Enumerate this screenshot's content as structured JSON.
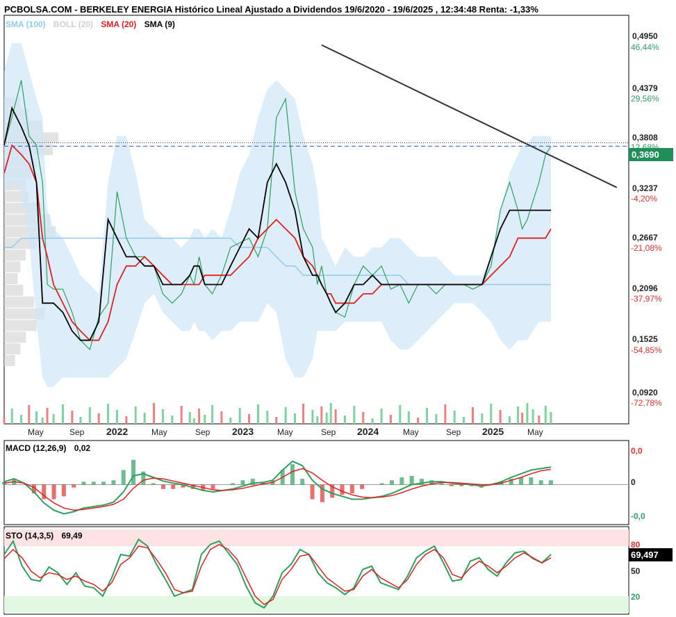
{
  "title": "PCBOLSA.COM - BERKELEY ENERGIA Histórico Lineal Ajustado a Dividendos 19/6/2020 - 19/6/2025 , 12:34:48 Renta: -1,33%",
  "legend": [
    {
      "label": "SMA (100)",
      "color": "#8fcbef"
    },
    {
      "label": "BOLL (20)",
      "color": "#d7d7d7"
    },
    {
      "label": "SMA (20)",
      "color": "#e02020"
    },
    {
      "label": "SMA (9)",
      "color": "#000000"
    }
  ],
  "price_axis": [
    {
      "price": "0,4950",
      "pct": "46,44%",
      "pct_color": "#2e9f5e"
    },
    {
      "price": "0,4379",
      "pct": "29,56%",
      "pct_color": "#2e9f5e"
    },
    {
      "price": "0,3808",
      "pct": "12,68%",
      "pct_color": "#2e9f5e"
    },
    {
      "price": "0,3237",
      "pct": "-4,20%",
      "pct_color": "#e03030"
    },
    {
      "price": "0,2667",
      "pct": "-21,08%",
      "pct_color": "#e03030"
    },
    {
      "price": "0,2096",
      "pct": "-37,97%",
      "pct_color": "#e03030"
    },
    {
      "price": "0,1525",
      "pct": "-54,85%",
      "pct_color": "#e03030"
    },
    {
      "price": "0,0920",
      "pct": "-72,78%",
      "pct_color": "#e03030"
    }
  ],
  "current_price": "0,3690",
  "x_axis": [
    {
      "label": "May",
      "year": false
    },
    {
      "label": "Sep",
      "year": false
    },
    {
      "label": "2022",
      "year": true
    },
    {
      "label": "May",
      "year": false
    },
    {
      "label": "Sep",
      "year": false
    },
    {
      "label": "2023",
      "year": true
    },
    {
      "label": "May",
      "year": false
    },
    {
      "label": "Sep",
      "year": false
    },
    {
      "label": "2024",
      "year": true
    },
    {
      "label": "May",
      "year": false
    },
    {
      "label": "Sep",
      "year": false
    },
    {
      "label": "2025",
      "year": true
    },
    {
      "label": "May",
      "year": false
    }
  ],
  "macd": {
    "label": "MACD (12,26,9)",
    "value": "0,02",
    "axis": [
      {
        "label": "0,0",
        "color": "#e03030"
      },
      {
        "label": "0",
        "color": "#222222"
      },
      {
        "label": "-0,0",
        "color": "#2e9f5e"
      }
    ]
  },
  "sto": {
    "label": "STO (14,3,5)",
    "value": "69,49",
    "current": "69,497",
    "axis": [
      {
        "label": "80",
        "color": "#e03030"
      },
      {
        "label": "50",
        "color": "#222222"
      },
      {
        "label": "20",
        "color": "#2e9f5e"
      }
    ]
  },
  "chart_data": {
    "type": "line",
    "title": "PCBOLSA.COM - BERKELEY ENERGIA Histórico Lineal Ajustado a Dividendos 19/6/2020 - 19/6/2025",
    "x_range": [
      "2020-06-19",
      "2025-06-19"
    ],
    "ylim": [
      0.07,
      0.51
    ],
    "y_scale": "linear",
    "grid": false,
    "legend_position": "top-left",
    "current_price": 0.369,
    "trendline": {
      "from": [
        "2023-05-15",
        0.478
      ],
      "to": [
        "2025-06-30",
        0.347
      ]
    },
    "dates": [
      "2020-06-19",
      "2020-07-15",
      "2020-08-15",
      "2020-09-10",
      "2020-10-05",
      "2020-10-25",
      "2020-11-10",
      "2020-12-01",
      "2021-01-01",
      "2021-02-01",
      "2021-03-01",
      "2021-04-01",
      "2021-05-01",
      "2021-06-01",
      "2021-07-01",
      "2021-08-01",
      "2021-09-01",
      "2021-10-01",
      "2021-11-01",
      "2021-12-01",
      "2022-01-01",
      "2022-02-01",
      "2022-03-01",
      "2022-03-15",
      "2022-04-01",
      "2022-04-20",
      "2022-05-15",
      "2022-06-15",
      "2022-07-15",
      "2022-08-15",
      "2022-09-15",
      "2022-10-15",
      "2022-11-15",
      "2022-12-15",
      "2023-01-15",
      "2023-02-15",
      "2023-03-15",
      "2023-04-15",
      "2023-05-01",
      "2023-05-15",
      "2023-06-01",
      "2023-06-15",
      "2023-07-01",
      "2023-08-01",
      "2023-09-01",
      "2023-10-01",
      "2023-11-01",
      "2023-12-01",
      "2024-01-01",
      "2024-02-01",
      "2024-03-01",
      "2024-04-01",
      "2024-05-01",
      "2024-06-01",
      "2024-07-01",
      "2024-08-01",
      "2024-09-01",
      "2024-10-01",
      "2024-11-01",
      "2024-12-01",
      "2025-01-01",
      "2025-02-01",
      "2025-03-01",
      "2025-03-15",
      "2025-04-01",
      "2025-04-20",
      "2025-05-10",
      "2025-06-01",
      "2025-06-19"
    ],
    "series": [
      {
        "name": "BERKELEY ENERGIA",
        "color": "#2e9f5e",
        "values": [
          0.37,
          0.4,
          0.44,
          0.38,
          0.37,
          0.33,
          0.22,
          0.215,
          0.215,
          0.19,
          0.16,
          0.15,
          0.185,
          0.2,
          0.32,
          0.27,
          0.25,
          0.25,
          0.24,
          0.21,
          0.2,
          0.21,
          0.23,
          0.22,
          0.25,
          0.22,
          0.21,
          0.23,
          0.26,
          0.265,
          0.27,
          0.25,
          0.28,
          0.4,
          0.42,
          0.32,
          0.28,
          0.26,
          0.22,
          0.24,
          0.21,
          0.2,
          0.19,
          0.185,
          0.22,
          0.24,
          0.23,
          0.24,
          0.215,
          0.22,
          0.2,
          0.22,
          0.22,
          0.21,
          0.22,
          0.22,
          0.22,
          0.215,
          0.22,
          0.24,
          0.3,
          0.33,
          0.3,
          0.28,
          0.29,
          0.31,
          0.33,
          0.36,
          0.369
        ]
      },
      {
        "name": "SMA (9)",
        "color": "#000000",
        "values": [
          0.37,
          0.41,
          0.39,
          0.37,
          0.33,
          0.2,
          0.2,
          0.2,
          0.19,
          0.17,
          0.16,
          0.16,
          0.18,
          0.29,
          0.27,
          0.25,
          0.25,
          0.24,
          0.24,
          0.22,
          0.22,
          0.22,
          0.23,
          0.24,
          0.24,
          0.22,
          0.22,
          0.22,
          0.24,
          0.26,
          0.28,
          0.27,
          0.33,
          0.35,
          0.33,
          0.3,
          0.25,
          0.23,
          0.23,
          0.22,
          0.21,
          0.2,
          0.19,
          0.2,
          0.22,
          0.22,
          0.23,
          0.22,
          0.22,
          0.22,
          0.22,
          0.22,
          0.22,
          0.22,
          0.22,
          0.22,
          0.22,
          0.22,
          0.22,
          0.25,
          0.28,
          0.3,
          0.3,
          0.3,
          0.3,
          0.3,
          0.3,
          0.3,
          0.3
        ]
      },
      {
        "name": "SMA (20)",
        "color": "#e02020",
        "values": [
          0.34,
          0.37,
          0.36,
          0.35,
          0.33,
          0.27,
          0.25,
          0.22,
          0.2,
          0.18,
          0.17,
          0.16,
          0.16,
          0.18,
          0.22,
          0.24,
          0.24,
          0.25,
          0.24,
          0.23,
          0.22,
          0.22,
          0.22,
          0.22,
          0.22,
          0.23,
          0.23,
          0.23,
          0.23,
          0.24,
          0.25,
          0.27,
          0.28,
          0.29,
          0.28,
          0.27,
          0.25,
          0.24,
          0.23,
          0.22,
          0.21,
          0.21,
          0.2,
          0.2,
          0.2,
          0.21,
          0.21,
          0.22,
          0.22,
          0.22,
          0.22,
          0.22,
          0.22,
          0.22,
          0.22,
          0.22,
          0.22,
          0.22,
          0.22,
          0.23,
          0.24,
          0.25,
          0.27,
          0.27,
          0.27,
          0.27,
          0.27,
          0.27,
          0.28
        ]
      },
      {
        "name": "SMA (100)",
        "color": "#8fcbef",
        "values": [
          0.26,
          0.26,
          0.27,
          0.27,
          0.27,
          0.27,
          0.27,
          0.27,
          0.27,
          0.27,
          0.27,
          0.27,
          0.27,
          0.27,
          0.27,
          0.27,
          0.27,
          0.27,
          0.27,
          0.27,
          0.27,
          0.27,
          0.27,
          0.27,
          0.27,
          0.27,
          0.27,
          0.27,
          0.27,
          0.26,
          0.26,
          0.26,
          0.26,
          0.25,
          0.24,
          0.24,
          0.23,
          0.23,
          0.23,
          0.23,
          0.23,
          0.23,
          0.23,
          0.23,
          0.23,
          0.23,
          0.23,
          0.23,
          0.23,
          0.23,
          0.22,
          0.22,
          0.22,
          0.22,
          0.22,
          0.22,
          0.22,
          0.22,
          0.22,
          0.22,
          0.22,
          0.22,
          0.22,
          0.22,
          0.22,
          0.22,
          0.22,
          0.22,
          0.22
        ]
      }
    ],
    "bollinger": {
      "name": "BOLL (20)",
      "upper": [
        0.45,
        0.48,
        0.48,
        0.45,
        0.42,
        0.4,
        0.3,
        0.28,
        0.27,
        0.25,
        0.23,
        0.22,
        0.21,
        0.33,
        0.38,
        0.38,
        0.34,
        0.29,
        0.28,
        0.27,
        0.27,
        0.26,
        0.27,
        0.28,
        0.28,
        0.27,
        0.28,
        0.27,
        0.3,
        0.34,
        0.36,
        0.4,
        0.43,
        0.44,
        0.43,
        0.42,
        0.38,
        0.35,
        0.32,
        0.27,
        0.26,
        0.25,
        0.24,
        0.26,
        0.25,
        0.25,
        0.26,
        0.26,
        0.27,
        0.27,
        0.26,
        0.25,
        0.25,
        0.25,
        0.24,
        0.23,
        0.23,
        0.23,
        0.23,
        0.25,
        0.3,
        0.34,
        0.36,
        0.37,
        0.37,
        0.38,
        0.38,
        0.38,
        0.38
      ],
      "lower": [
        0.32,
        0.33,
        0.32,
        0.27,
        0.18,
        0.12,
        0.11,
        0.11,
        0.12,
        0.12,
        0.12,
        0.12,
        0.12,
        0.12,
        0.13,
        0.14,
        0.17,
        0.2,
        0.21,
        0.19,
        0.18,
        0.17,
        0.17,
        0.18,
        0.17,
        0.17,
        0.16,
        0.17,
        0.17,
        0.18,
        0.18,
        0.18,
        0.2,
        0.19,
        0.14,
        0.12,
        0.12,
        0.14,
        0.17,
        0.17,
        0.17,
        0.17,
        0.17,
        0.18,
        0.18,
        0.18,
        0.18,
        0.18,
        0.16,
        0.15,
        0.15,
        0.16,
        0.17,
        0.18,
        0.19,
        0.2,
        0.2,
        0.2,
        0.19,
        0.18,
        0.16,
        0.15,
        0.16,
        0.16,
        0.16,
        0.17,
        0.18,
        0.18,
        0.18
      ]
    },
    "volume_profile": [
      0.3,
      0.45,
      0.7,
      1.0,
      0.9,
      0.6,
      0.5,
      0.4,
      0.45,
      0.7,
      0.85,
      0.95,
      0.6,
      0.4,
      0.3,
      0.25,
      0.35,
      0.55,
      0.75,
      0.6,
      0.4,
      0.3,
      0.2
    ],
    "macd": {
      "range": [
        -0.05,
        0.05
      ],
      "macd_line": [
        0.004,
        0.008,
        0.002,
        -0.01,
        -0.025,
        -0.035,
        -0.04,
        -0.037,
        -0.032,
        -0.03,
        -0.028,
        -0.024,
        -0.01,
        0.012,
        0.015,
        0.01,
        0.005,
        0.002,
        0,
        -0.004,
        -0.008,
        -0.01,
        -0.008,
        -0.006,
        -0.002,
        0.002,
        0.003,
        0.006,
        0.02,
        0.032,
        0.026,
        0.006,
        -0.006,
        -0.012,
        -0.016,
        -0.02,
        -0.02,
        -0.018,
        -0.016,
        -0.012,
        -0.006,
        0,
        0.002,
        0.004,
        0.004,
        0.002,
        0.001,
        0.0,
        -0.002,
        0.0,
        0.004,
        0.01,
        0.015,
        0.02,
        0.022,
        0.024
      ],
      "signal_line": [
        0.002,
        0.004,
        0.002,
        -0.004,
        -0.015,
        -0.025,
        -0.032,
        -0.035,
        -0.034,
        -0.032,
        -0.03,
        -0.027,
        -0.02,
        -0.005,
        0.006,
        0.009,
        0.008,
        0.005,
        0.002,
        -0.001,
        -0.004,
        -0.007,
        -0.008,
        -0.007,
        -0.005,
        -0.002,
        0.001,
        0.003,
        0.01,
        0.018,
        0.022,
        0.016,
        0.006,
        -0.003,
        -0.009,
        -0.014,
        -0.017,
        -0.018,
        -0.017,
        -0.015,
        -0.011,
        -0.006,
        -0.002,
        0.001,
        0.003,
        0.003,
        0.002,
        0.001,
        0.0,
        0.0,
        0.002,
        0.006,
        0.01,
        0.015,
        0.019,
        0.021
      ]
    },
    "stochastic": {
      "range": [
        0,
        100
      ],
      "k": [
        70,
        86,
        56,
        40,
        38,
        55,
        48,
        34,
        48,
        32,
        30,
        20,
        42,
        70,
        68,
        88,
        80,
        58,
        40,
        20,
        24,
        28,
        70,
        82,
        86,
        72,
        58,
        32,
        12,
        6,
        20,
        48,
        58,
        76,
        70,
        48,
        36,
        30,
        22,
        30,
        52,
        56,
        36,
        32,
        28,
        44,
        66,
        74,
        80,
        60,
        38,
        40,
        62,
        66,
        52,
        44,
        60,
        72,
        74,
        65,
        60,
        70
      ],
      "d": [
        65,
        76,
        66,
        50,
        42,
        48,
        46,
        40,
        44,
        38,
        34,
        26,
        36,
        58,
        66,
        80,
        78,
        64,
        48,
        28,
        24,
        26,
        56,
        76,
        82,
        76,
        64,
        42,
        20,
        10,
        16,
        40,
        52,
        68,
        70,
        56,
        42,
        34,
        26,
        28,
        44,
        52,
        42,
        36,
        30,
        40,
        58,
        70,
        76,
        66,
        46,
        42,
        54,
        62,
        56,
        48,
        56,
        66,
        72,
        66,
        60,
        66
      ]
    }
  }
}
